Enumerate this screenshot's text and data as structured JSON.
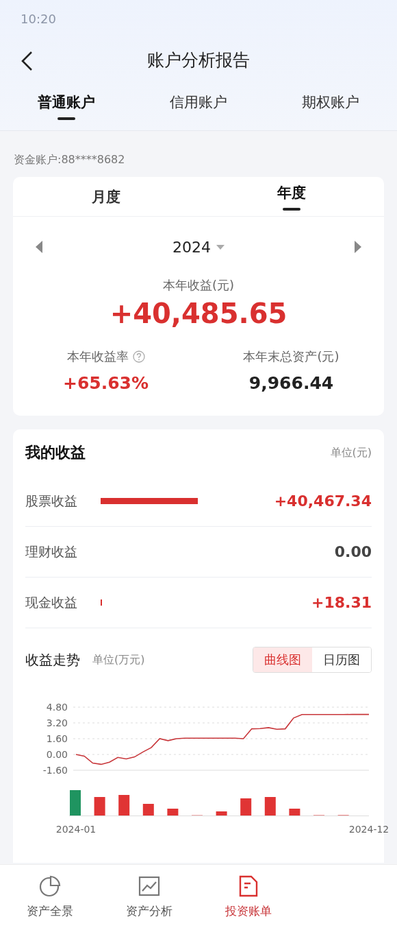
{
  "status_bar": {
    "time": "10:20"
  },
  "header": {
    "title": "账户分析报告"
  },
  "account_tabs": [
    {
      "label": "普通账户",
      "selected": true
    },
    {
      "label": "信用账户",
      "selected": false
    },
    {
      "label": "期权账户",
      "selected": false
    }
  ],
  "account_number": "资金账户:88****8682",
  "summary": {
    "period_tabs": [
      {
        "label": "月度",
        "selected": false
      },
      {
        "label": "年度",
        "selected": true
      }
    ],
    "year": "2024",
    "income_label": "本年收益(元)",
    "income_value": "+40,485.65",
    "rate_label": "本年收益率",
    "rate_value": "+65.63%",
    "assets_label": "本年末总资产(元)",
    "assets_value": "9,966.44"
  },
  "my_income": {
    "title": "我的收益",
    "unit": "单位(元)",
    "rows": [
      {
        "label": "股票收益",
        "value": "+40,467.34",
        "kind": "gain"
      },
      {
        "label": "理财收益",
        "value": "0.00",
        "kind": "flat"
      },
      {
        "label": "现金收益",
        "value": "+18.31",
        "kind": "gain"
      }
    ],
    "trend_title": "收益走势",
    "trend_unit": "单位(万元)",
    "view_toggle": [
      {
        "label": "曲线图",
        "selected": true
      },
      {
        "label": "日历图",
        "selected": false
      }
    ],
    "chart_data": {
      "type": "line",
      "categories": [
        "2024-01",
        null,
        null,
        null,
        null,
        null,
        null,
        null,
        null,
        null,
        null,
        null,
        null,
        null,
        null,
        null,
        null,
        null,
        null,
        null,
        null,
        null,
        null,
        null,
        null,
        null,
        null,
        null,
        null,
        null,
        null,
        null,
        null,
        null,
        null,
        "2024-12"
      ],
      "series": [
        {
          "color": "#c8363a",
          "values": [
            0,
            -0.17,
            -0.87,
            -1.0,
            -0.78,
            -0.3,
            -0.45,
            -0.25,
            0.25,
            0.7,
            1.6,
            1.4,
            1.6,
            1.65,
            1.65,
            1.65,
            1.65,
            1.65,
            1.65,
            1.65,
            1.6,
            2.6,
            2.62,
            2.72,
            2.55,
            2.6,
            3.7,
            4.05,
            4.05,
            4.05,
            4.05,
            4.05,
            4.05,
            4.06,
            4.06,
            4.06
          ]
        }
      ],
      "grid": true,
      "ylim": [
        -1.6,
        4.8
      ],
      "yticks": [
        {
          "value": 4.8,
          "label": "4.80"
        },
        {
          "value": 3.2,
          "label": "3.20"
        },
        {
          "value": 1.6,
          "label": "1.60"
        },
        {
          "value": 0,
          "label": "0.00"
        },
        {
          "value": -1.6,
          "label": "-1.60"
        }
      ]
    }
  },
  "bottom_nav": [
    {
      "label": "资产全景",
      "selected": false
    },
    {
      "label": "资产分析",
      "selected": false
    },
    {
      "label": "投资账单",
      "selected": true
    }
  ]
}
